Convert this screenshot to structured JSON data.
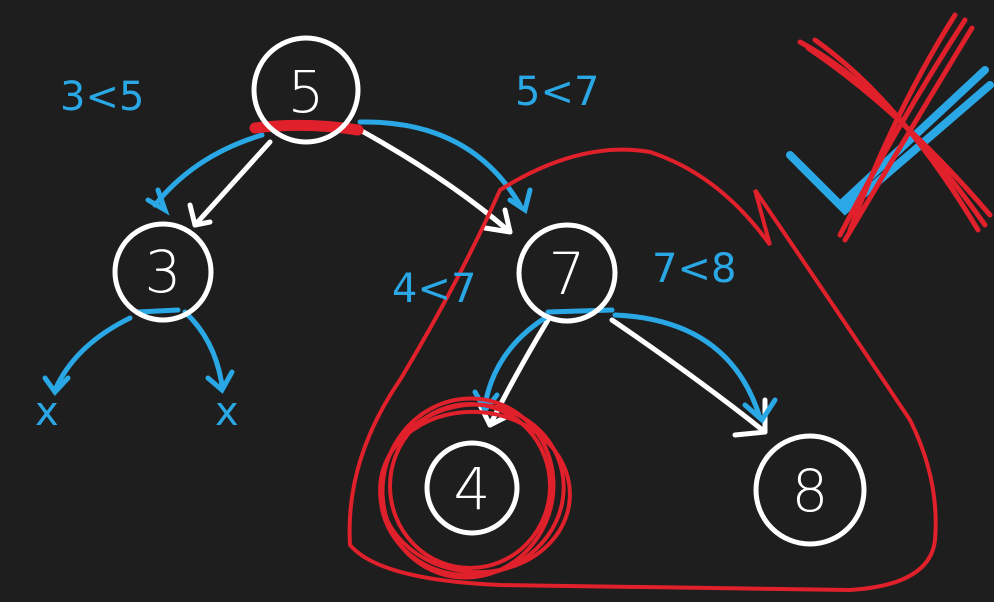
{
  "diagram": {
    "nodes": [
      {
        "id": "root",
        "label": "5"
      },
      {
        "id": "left",
        "label": "3"
      },
      {
        "id": "right",
        "label": "7"
      },
      {
        "id": "right-left",
        "label": "4"
      },
      {
        "id": "right-right",
        "label": "8"
      }
    ],
    "annotations": {
      "compare_root_left": "3<5",
      "compare_root_right": "5<7",
      "compare_right_left": "4<7",
      "compare_right_right": "7<8",
      "null_left_1": "x",
      "null_left_2": "x"
    },
    "verdict": "invalid BST",
    "colors": {
      "background": "#1e1e1e",
      "node_stroke": "#ffffff",
      "blue_annotation": "#2aa8e6",
      "red_markup": "#e0202a"
    }
  }
}
